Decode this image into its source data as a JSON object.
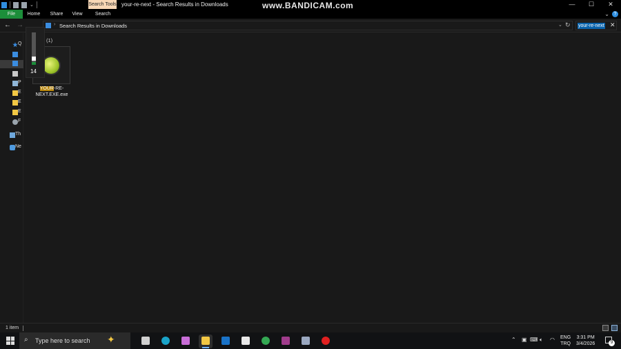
{
  "window": {
    "title": "your-re-next - Search Results in Downloads",
    "context_tab": "Search Tools",
    "watermark": "www.BANDICAM.com",
    "controls": {
      "minimize": "—",
      "maximize": "☐",
      "close": "✕"
    }
  },
  "ribbon": {
    "tabs": [
      "File",
      "Home",
      "Share",
      "View",
      "Search"
    ],
    "collapse_glyph": "⌄",
    "help_glyph": "?"
  },
  "address": {
    "path": "Search Results in Downloads",
    "separator": "›",
    "search_query": "your-re-next",
    "clear_glyph": "✕"
  },
  "nav_pane": {
    "items": [
      {
        "icon": "star-icon",
        "label": "Q"
      },
      {
        "icon": "desktop-icon",
        "label": ""
      },
      {
        "icon": "download-icon",
        "label": ""
      },
      {
        "icon": "document-icon",
        "label": ""
      },
      {
        "icon": "pictures-icon",
        "label": "P"
      },
      {
        "icon": "folder-icon",
        "label": "E"
      },
      {
        "icon": "folder-icon",
        "label": "E"
      },
      {
        "icon": "folder-icon",
        "label": "E"
      },
      {
        "icon": "search-folder-icon",
        "label": "F"
      },
      {
        "icon": "pc-icon",
        "label": "Th"
      },
      {
        "icon": "network-icon",
        "label": "Ne"
      }
    ]
  },
  "content": {
    "group_count": "(1)",
    "file": {
      "name_highlight": "YOUR",
      "name_rest_line1": "-RE-",
      "name_line2": "NEXT.EXE.exe",
      "icon": "app-green-ball-icon"
    }
  },
  "volume_flyout": {
    "level": "14",
    "level_fraction": 0.14
  },
  "status": {
    "items_text": "1 item"
  },
  "taskbar": {
    "search_placeholder": "Type here to search",
    "copilot_glyph": "✦",
    "apps": [
      {
        "name": "task-view-icon",
        "color": "#d0d0d0"
      },
      {
        "name": "edge-icon",
        "color": "#1aa3c8"
      },
      {
        "name": "copilot-icon",
        "color": "#c86dd7"
      },
      {
        "name": "file-explorer-icon",
        "color": "#f2c744"
      },
      {
        "name": "outlook-icon",
        "color": "#1a73c8"
      },
      {
        "name": "store-icon",
        "color": "#e8e8e8"
      },
      {
        "name": "chrome-icon",
        "color": "#34a853"
      },
      {
        "name": "winrar-icon",
        "color": "#a03c8c"
      },
      {
        "name": "app-icon",
        "color": "#9aa8c0"
      },
      {
        "name": "bandicam-record-icon",
        "color": "#e02020"
      }
    ],
    "tray": {
      "chevron": "⌃",
      "language_line1": "ENG",
      "language_line2": "TRQ",
      "time": "3:31 PM",
      "date": "3/4/2026",
      "notifications": "9"
    }
  }
}
